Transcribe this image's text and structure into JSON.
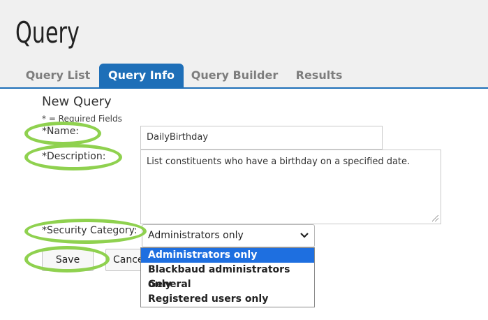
{
  "app": {
    "title": "Query"
  },
  "tabs": [
    {
      "label": "Query List",
      "active": false
    },
    {
      "label": "Query Info",
      "active": true
    },
    {
      "label": "Query Builder",
      "active": false
    },
    {
      "label": "Results",
      "active": false
    }
  ],
  "form": {
    "title": "New Query",
    "required_note": "* = Required Fields",
    "name_label": "*Name:",
    "name_value": "DailyBirthday",
    "description_label": "*Description:",
    "description_value": "List constituents who have a birthday on a specified date.",
    "security_label": "*Security Category:",
    "security_selected": "Administrators only",
    "security_options": [
      "Administrators only",
      "Blackbaud administrators only",
      "General",
      "Registered users only"
    ],
    "save_label": "Save",
    "cancel_label": "Cancel"
  },
  "colors": {
    "accent": "#1e6fb8",
    "highlight_ring": "#8fd14f",
    "selected_option": "#1e6fe0"
  },
  "icons": {
    "select_chevron": "chevron-down-icon"
  }
}
